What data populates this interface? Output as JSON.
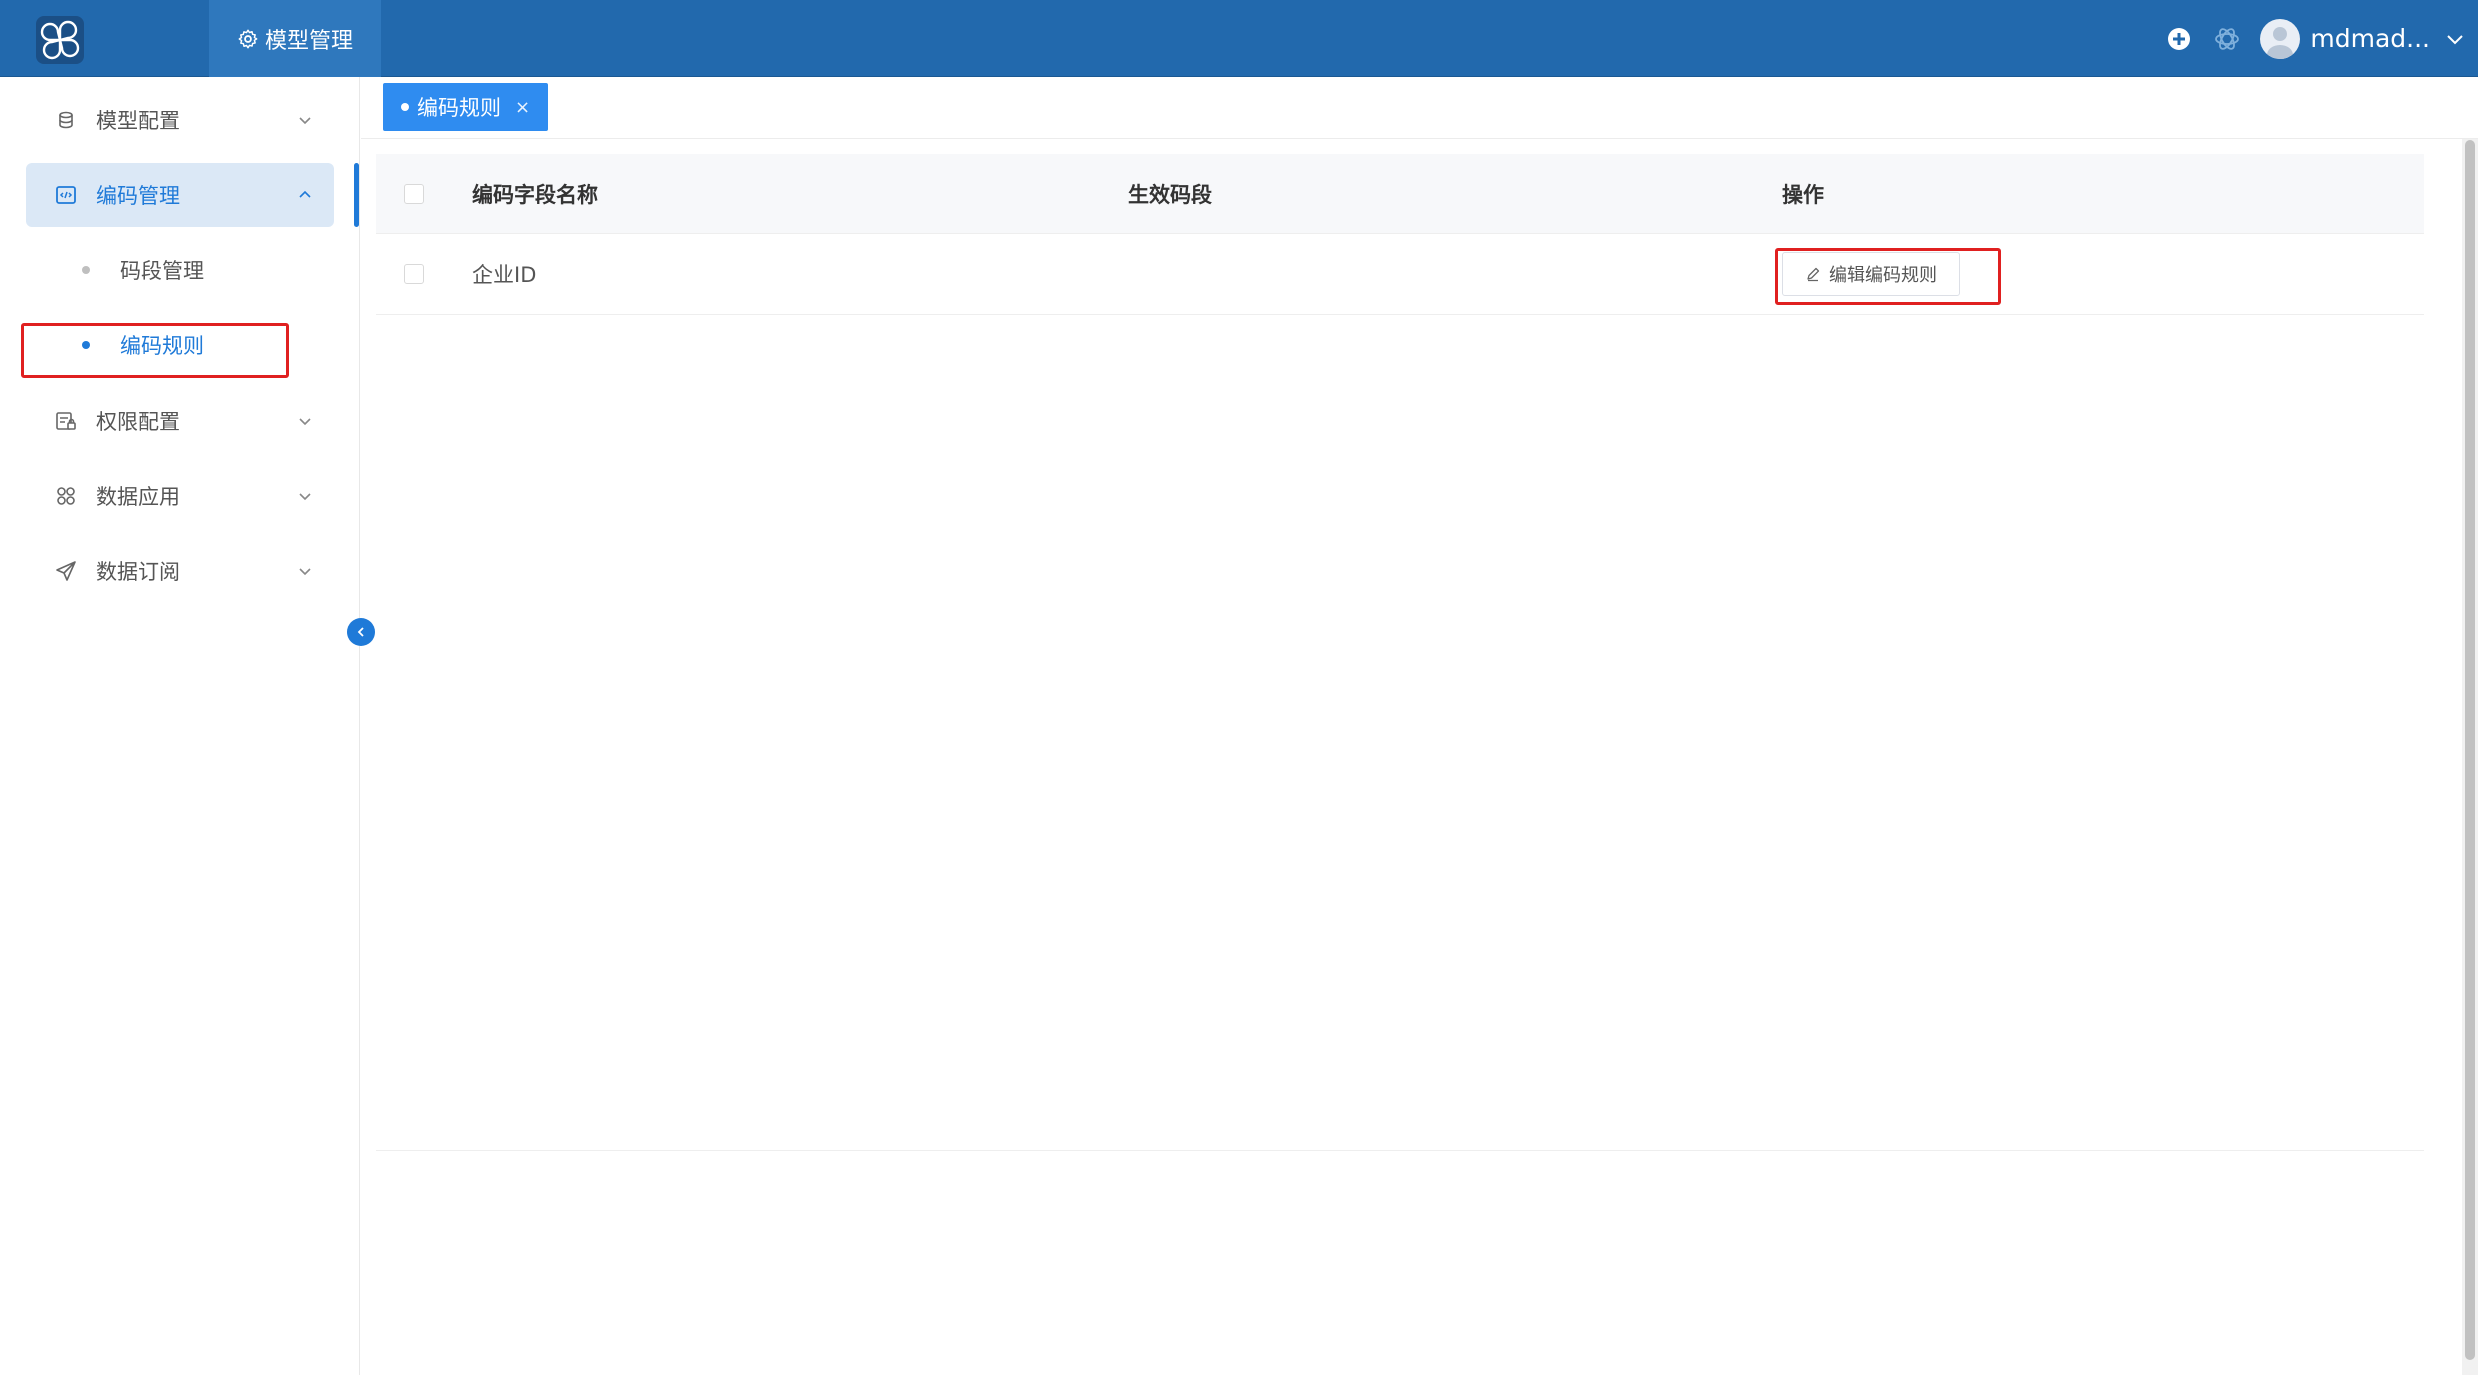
{
  "header": {
    "logo_icon": "app-logo-icon",
    "active_nav": {
      "icon": "gear-icon",
      "label": "模型管理"
    },
    "right_icons": [
      "plus-circle-icon",
      "openai-icon"
    ],
    "user": {
      "name": "mdmad...",
      "avatar_icon": "user-avatar-icon",
      "chevron": "chevron-down-icon"
    }
  },
  "sidebar": {
    "items": [
      {
        "label": "模型配置",
        "icon": "database-icon",
        "expanded": false
      },
      {
        "label": "编码管理",
        "icon": "code-icon",
        "expanded": true,
        "active": true,
        "children": [
          {
            "label": "码段管理",
            "active": false
          },
          {
            "label": "编码规则",
            "active": true
          }
        ]
      },
      {
        "label": "权限配置",
        "icon": "permission-icon",
        "expanded": false
      },
      {
        "label": "数据应用",
        "icon": "grid-icon",
        "expanded": false
      },
      {
        "label": "数据订阅",
        "icon": "send-icon",
        "expanded": false
      }
    ],
    "collapse_icon": "chevron-left-icon"
  },
  "tabs": [
    {
      "label": "编码规则",
      "active": true,
      "close": "×"
    }
  ],
  "table": {
    "columns": [
      "编码字段名称",
      "生效码段",
      "操作"
    ],
    "rows": [
      {
        "name": "企业ID",
        "segment": "",
        "action": "编辑编码规则"
      }
    ]
  },
  "colors": {
    "header_bg": "#2269ad",
    "accent": "#1f7ad8",
    "tab_active": "#2f8cf0",
    "highlight": "#e02020"
  }
}
